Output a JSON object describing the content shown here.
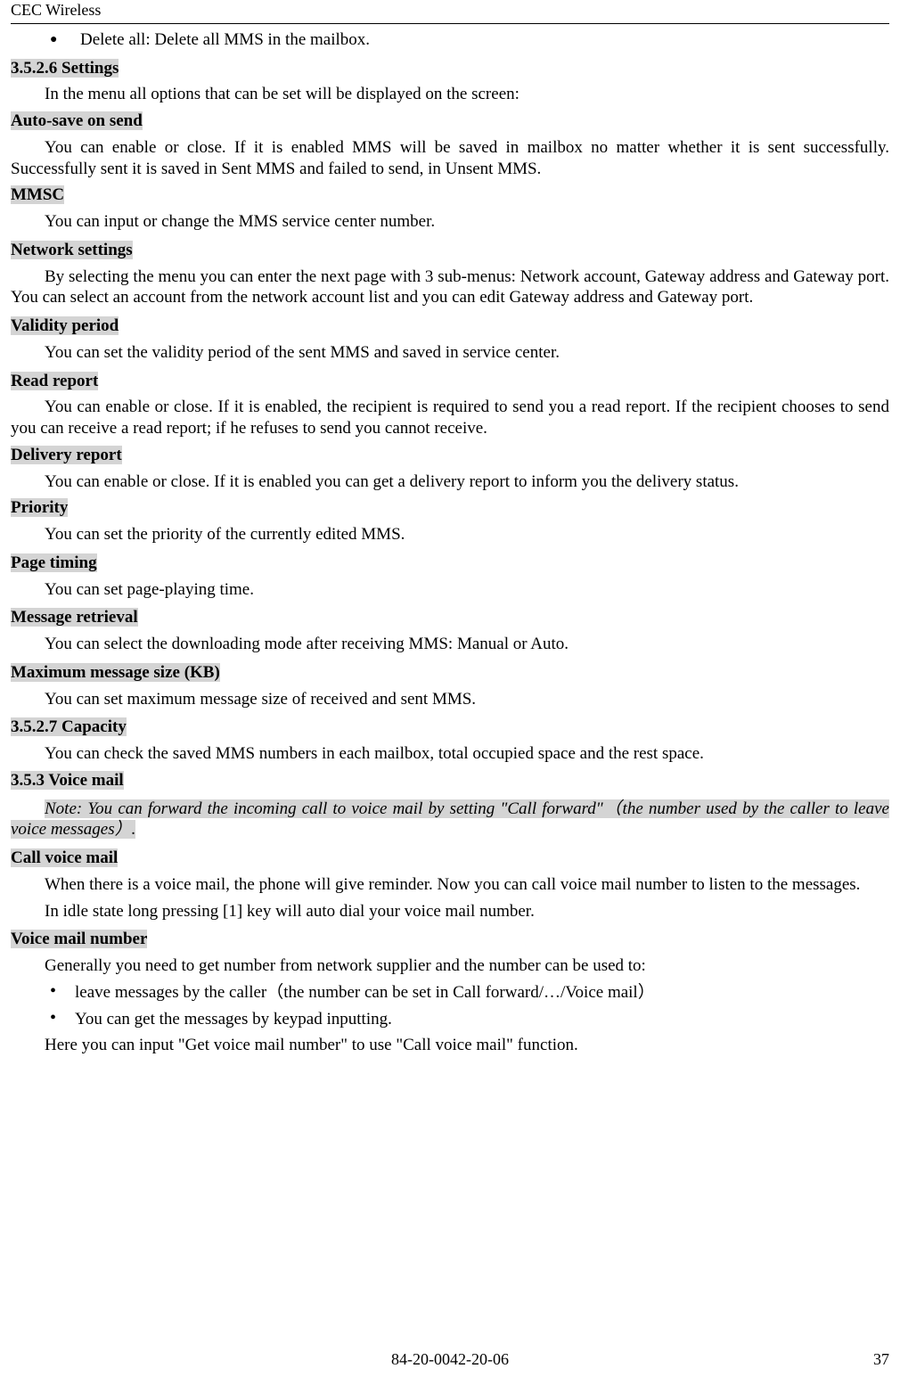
{
  "header": {
    "brand": "CEC Wireless"
  },
  "bullet1": {
    "text": "Delete all: Delete all MMS in the mailbox."
  },
  "s3526": {
    "heading": "3.5.2.6 Settings",
    "intro": "In the menu all options that can be set will be displayed on the screen:",
    "auto_save": {
      "title": "Auto-save on send",
      "body": "You can enable or close. If it is enabled MMS will be saved in mailbox no matter whether it is sent successfully. Successfully sent it is saved in Sent MMS and failed to send, in Unsent MMS."
    },
    "mmsc": {
      "title": "MMSC",
      "body": "You can input or change the MMS service center number."
    },
    "network": {
      "title": "Network settings",
      "body": "By selecting the menu you can enter the next page with 3 sub-menus: Network account, Gateway address and Gateway port. You can select an account from the network account list and you can edit Gateway address and Gateway port."
    },
    "validity": {
      "title": "Validity period",
      "body": "You can set the validity period of the sent MMS and saved in service center."
    },
    "read_report": {
      "title": "Read report",
      "body": "You can enable or close. If it is enabled, the recipient is required to send you a read report. If the recipient chooses to send you can receive a read report; if he refuses to send you cannot receive."
    },
    "delivery_report": {
      "title": "Delivery report",
      "body": "You can enable or close. If it is enabled you can get a delivery report to inform you the delivery status."
    },
    "priority": {
      "title": "Priority",
      "body": "You can set the priority of the currently edited MMS."
    },
    "page_timing": {
      "title": "Page timing",
      "body": "You can set page-playing time."
    },
    "msg_retrieval": {
      "title": "Message retrieval",
      "body": "You can select the downloading mode after receiving MMS: Manual or Auto."
    },
    "max_size": {
      "title": "Maximum message size (KB)",
      "body": "You can set maximum message size of received and sent MMS."
    }
  },
  "s3527": {
    "heading": "3.5.2.7 Capacity",
    "body": "You can check the saved MMS numbers in each mailbox, total occupied space and the rest space."
  },
  "s353": {
    "heading": "3.5.3 Voice mail",
    "note_a": "Note: You can forward the incoming call to voice mail by setting \"Call forward\"",
    "note_b": "（the number used by the caller to leave voice messages）.",
    "call_voice": {
      "title": "Call voice mail",
      "body1": "When there is a voice mail, the phone will give reminder. Now you can call voice mail number to listen to the messages.",
      "body2": "In idle state long pressing [1] key will auto dial your voice mail number."
    },
    "voice_number": {
      "title": "Voice mail number",
      "body": "Generally you need to get number from network supplier and the number can be used to:",
      "bul1": "leave messages by the caller（the number can be set in Call forward/…/Voice mail）",
      "bul2": "You can get the messages by keypad inputting.",
      "after": "Here you can input \"Get voice mail number\" to use \"Call voice mail\" function."
    }
  },
  "footer": {
    "code": "84-20-0042-20-06",
    "page": "37"
  }
}
